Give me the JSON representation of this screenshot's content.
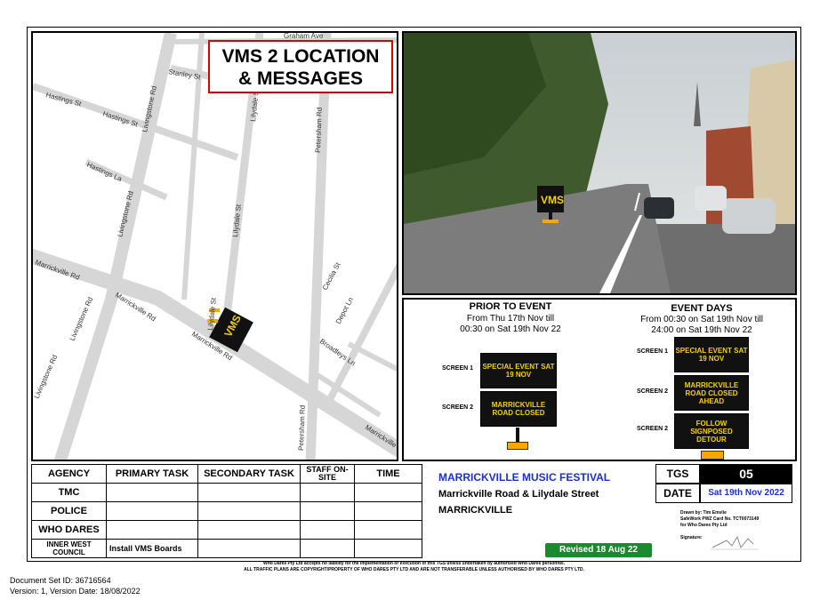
{
  "title": {
    "line1": "VMS 2 LOCATION",
    "line2": "& MESSAGES"
  },
  "map": {
    "streets": [
      "Graham Ave",
      "Stanley St",
      "Hastings St",
      "Hastings St",
      "Hastings La",
      "Livingstone Rd",
      "Livingstone Rd",
      "Lilydale St",
      "Lilydale St",
      "Lilydale St",
      "Petersham Rd",
      "Petersham Rd",
      "Cecilia St",
      "Marrickville Rd",
      "Marrickville Rd",
      "Marrickville Rd",
      "Marrickville",
      "Livingstone Rd",
      "Livingstone Rd",
      "Broadleys Ln",
      "Depot Ln"
    ],
    "vms_label": "VMS"
  },
  "photo": {
    "vms_label": "VMS"
  },
  "prior": {
    "heading": "PRIOR TO EVENT",
    "line1": "From Thu 17th Nov till",
    "line2": "00:30 on Sat 19th Nov 22",
    "screens": [
      {
        "label": "SCREEN 1",
        "text": "SPECIAL EVENT SAT 19 NOV"
      },
      {
        "label": "SCREEN 2",
        "text": "MARRICKVILLE ROAD CLOSED"
      }
    ]
  },
  "event": {
    "heading": "EVENT DAYS",
    "line1": "From 00:30 on Sat 19th Nov till",
    "line2": "24:00 on Sat 19th Nov 22",
    "screens": [
      {
        "label": "SCREEN 1",
        "text": "SPECIAL EVENT SAT 19 NOV"
      },
      {
        "label": "SCREEN 2",
        "text": "MARRICKVILLE ROAD CLOSED AHEAD"
      },
      {
        "label": "SCREEN 2",
        "text": "FOLLOW SIGNPOSED DETOUR"
      }
    ]
  },
  "task_table": {
    "headers": [
      "AGENCY",
      "PRIMARY TASK",
      "SECONDARY TASK",
      "STAFF ON-SITE",
      "TIME"
    ],
    "rows": [
      {
        "agency": "TMC",
        "primary": ""
      },
      {
        "agency": "POLICE",
        "primary": ""
      },
      {
        "agency": "WHO DARES",
        "primary": ""
      },
      {
        "agency": "INNER WEST COUNCIL",
        "primary": "Install VMS Boards"
      }
    ]
  },
  "info": {
    "event_name": "MARRICKVILLE MUSIC FESTIVAL",
    "location": "Marrickville Road & Lilydale Street",
    "suburb": "MARRICKVILLE",
    "revised": "Revised 18 Aug 22"
  },
  "tgs": {
    "tgs_label": "TGS",
    "tgs_number": "05",
    "date_label": "DATE",
    "date_value": "Sat 19th Nov 2022",
    "drawn_by": "Drawn by: Tim Emslie",
    "card": "SafeWork PWZ Card No. TCT0073149",
    "company": "for Who Dares Pty Ltd",
    "signature_label": "Signature:"
  },
  "disclaimer": {
    "line1": "Who Dares Pty Ltd accepts no liability for the implementation or execution of this TGS unless undertaken by authorised Who Dares personnel.",
    "line2": "ALL TRAFFIC PLANS ARE COPYRIGHT/PROPERTY OF WHO DARES PTY LTD AND ARE NOT TRANSFERABLE UNLESS AUTHORISED BY WHO DARES PTY LTD."
  },
  "document": {
    "set_id": "Document Set ID: 36716564",
    "version": "Version: 1, Version Date: 18/08/2022"
  },
  "colors": {
    "vms_yellow": "#f5d000",
    "board_black": "#111111",
    "revised_green": "#1a8a2e",
    "title_red": "#dd0000",
    "link_blue": "#1a2fd1"
  }
}
